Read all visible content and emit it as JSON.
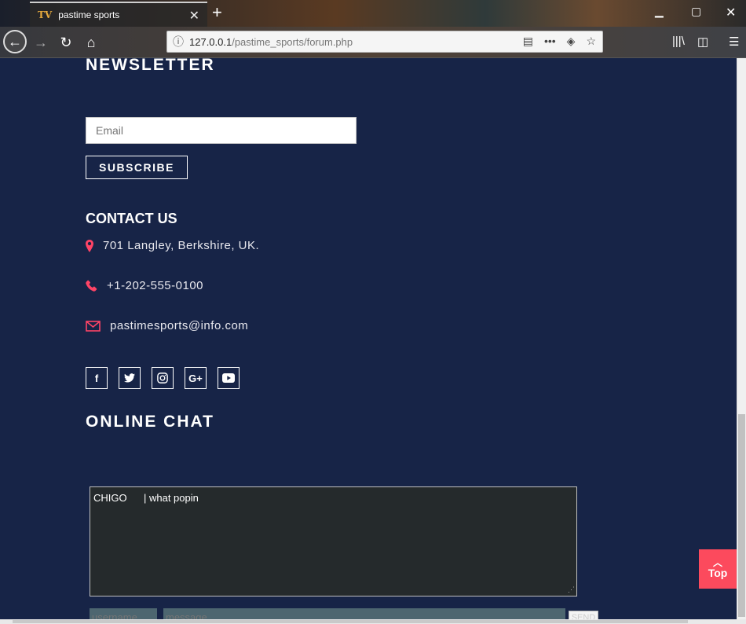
{
  "browser": {
    "tab_title": "pastime sports",
    "tab_favicon": "TV",
    "url_host": "127.0.0.1",
    "url_path": "/pastime_sports/forum.php"
  },
  "newsletter": {
    "heading": "NEWSLETTER",
    "email_placeholder": "Email",
    "subscribe_label": "SUBSCRIBE"
  },
  "contact": {
    "heading": "CONTACT US",
    "address": "701 Langley, Berkshire, UK.",
    "phone": "+1-202-555-0100",
    "email": "pastimesports@info.com"
  },
  "social": [
    {
      "icon": "facebook-icon",
      "glyph": "f"
    },
    {
      "icon": "twitter-icon",
      "glyph": "🐦"
    },
    {
      "icon": "instagram-icon",
      "glyph": "◎"
    },
    {
      "icon": "google-plus-icon",
      "glyph": "G+"
    },
    {
      "icon": "youtube-icon",
      "glyph": "▶"
    }
  ],
  "chat": {
    "heading": "ONLINE CHAT",
    "messages": [
      {
        "user": "CHIGO",
        "text": "| what popin"
      }
    ],
    "username_placeholder": "username",
    "message_placeholder": "message",
    "send_label": "SEND"
  },
  "top_button": {
    "label": "Top"
  },
  "colors": {
    "accent": "#fc4a5d",
    "page_bg": "#172447",
    "icon_pink": "#ff4466"
  }
}
